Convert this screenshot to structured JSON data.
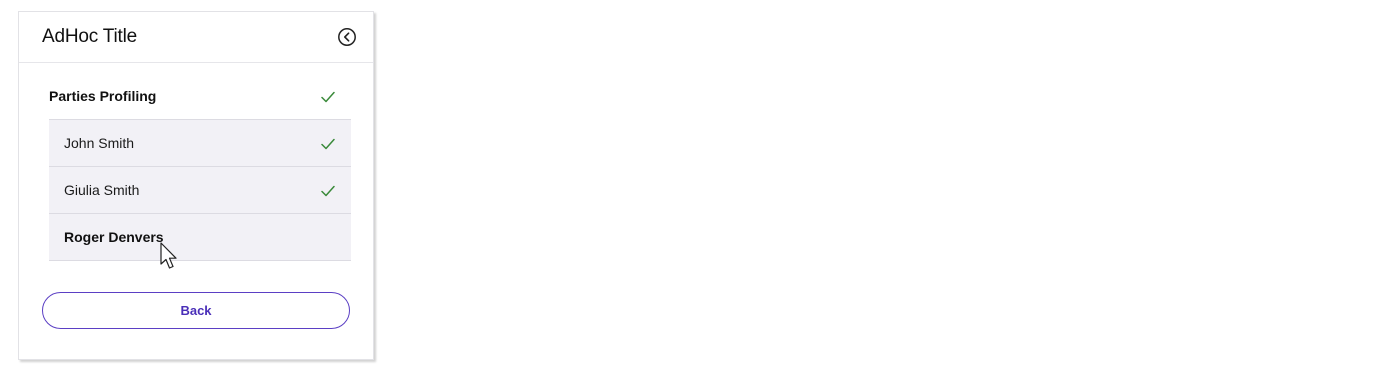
{
  "panel": {
    "title": "AdHoc Title",
    "collapse_icon": "chevron-left-circle-icon"
  },
  "section": {
    "label": "Parties Profiling",
    "completed": true
  },
  "subitems": [
    {
      "label": "John Smith",
      "completed": true,
      "active": false
    },
    {
      "label": "Giulia Smith",
      "completed": true,
      "active": false
    },
    {
      "label": "Roger Denvers",
      "completed": false,
      "active": true
    }
  ],
  "actions": {
    "back_label": "Back"
  },
  "colors": {
    "check": "#3a8a3a",
    "accent": "#4a2fb8",
    "row_bg": "#f2f1f6"
  }
}
